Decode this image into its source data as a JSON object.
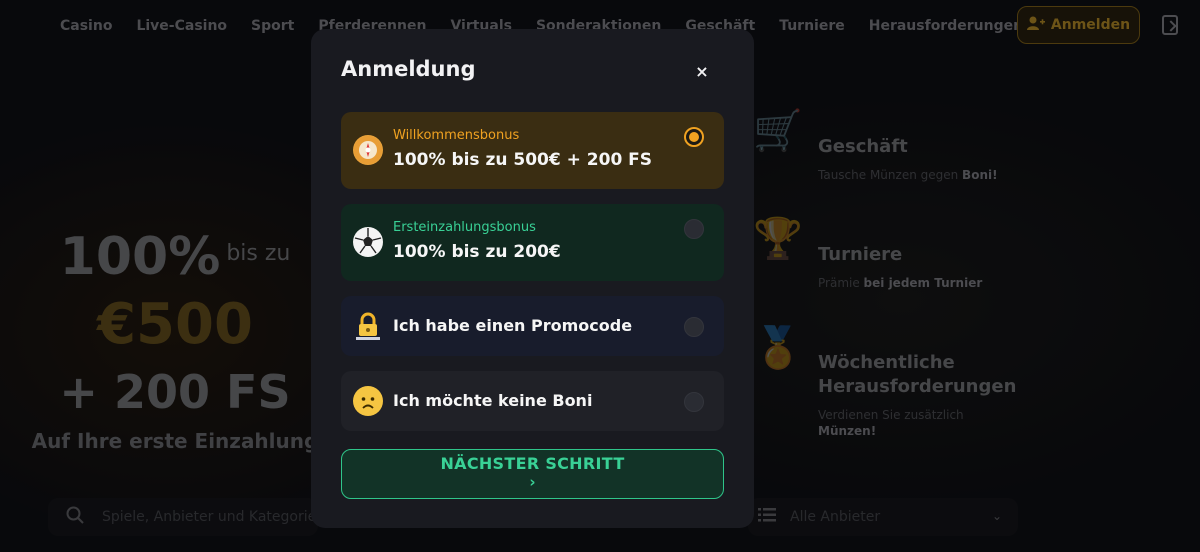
{
  "nav": {
    "links": [
      "Casino",
      "Live-Casino",
      "Sport",
      "Pferderennen",
      "Virtuals",
      "Sonderaktionen",
      "Geschäft",
      "Turniere",
      "Herausforderungen"
    ],
    "login_label": "Anmelden"
  },
  "hero": {
    "percent": "100%",
    "upto": "bis zu",
    "amount": "€500",
    "freespins": "+ 200 FS",
    "subtitle": "Auf Ihre erste Einzahlung"
  },
  "promos": [
    {
      "icon": "shopping-cart-icon",
      "title": "Geschäft",
      "desc_pre": "Tausche Münzen gegen ",
      "desc_bold": "Boni!",
      "desc_post": ""
    },
    {
      "icon": "trophy-icon",
      "title": "Turniere",
      "desc_pre": "Prämie ",
      "desc_bold": "bei jedem Turnier",
      "desc_post": ""
    },
    {
      "icon": "medal-icon",
      "title": "Wöchentliche Herausforderungen",
      "desc_pre": "Verdienen Sie zusätzlich ",
      "desc_bold": "Münzen!",
      "desc_post": ""
    }
  ],
  "search": {
    "placeholder": "Spiele, Anbieter und Kategorien su"
  },
  "providers": {
    "label": "Alle Anbieter"
  },
  "modal": {
    "title": "Anmeldung",
    "close": "×",
    "options": [
      {
        "small": "Willkommensbonus",
        "main": "100% bis zu 500€ + 200 FS",
        "selected": true
      },
      {
        "small": "Ersteinzahlungsbonus",
        "main": "100% bis zu 200€",
        "selected": false
      },
      {
        "main": "Ich habe einen Promocode",
        "selected": false
      },
      {
        "main": "Ich möchte keine Boni",
        "selected": false
      }
    ],
    "next_label": "NÄCHSTER SCHRITT",
    "next_arrow": "›"
  },
  "colors": {
    "accent_orange": "#f0a221",
    "accent_green": "#39d196",
    "modal_bg": "#191a20"
  }
}
